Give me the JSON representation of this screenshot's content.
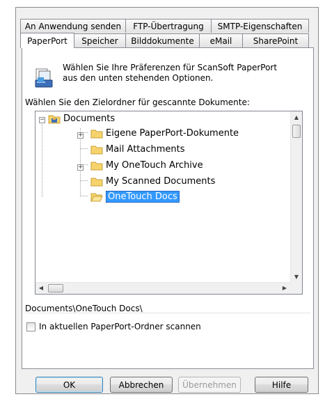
{
  "tabs_back": [
    "An Anwendung senden",
    "FTP-Übertragung",
    "SMTP-Eigenschaften"
  ],
  "tabs_front": [
    "PaperPort",
    "Speicher",
    "Bilddokumente",
    "eMail",
    "SharePoint"
  ],
  "active_tab": "PaperPort",
  "description": {
    "line1": "Wählen Sie Ihre Präferenzen für ScanSoft PaperPort",
    "line2": "aus den unten stehenden Optionen."
  },
  "target_label": "Wählen Sie den Zielordner für gescannte Dokumente:",
  "tree": {
    "root": "Documents",
    "items": [
      "Eigene PaperPort-Dokumente",
      "Mail Attachments",
      "My OneTouch Archive",
      "My Scanned Documents",
      "OneTouch Docs"
    ],
    "selected": "OneTouch Docs"
  },
  "selected_path": "Documents\\OneTouch Docs\\",
  "checkbox_label": "In aktuellen PaperPort-Ordner scannen",
  "checkbox_checked": false,
  "buttons": {
    "ok": "OK",
    "cancel": "Abbrechen",
    "apply": "Übernehmen",
    "help": "Hilfe"
  },
  "colors": {
    "selection": "#3399ff",
    "folder": "#f6d36b"
  }
}
